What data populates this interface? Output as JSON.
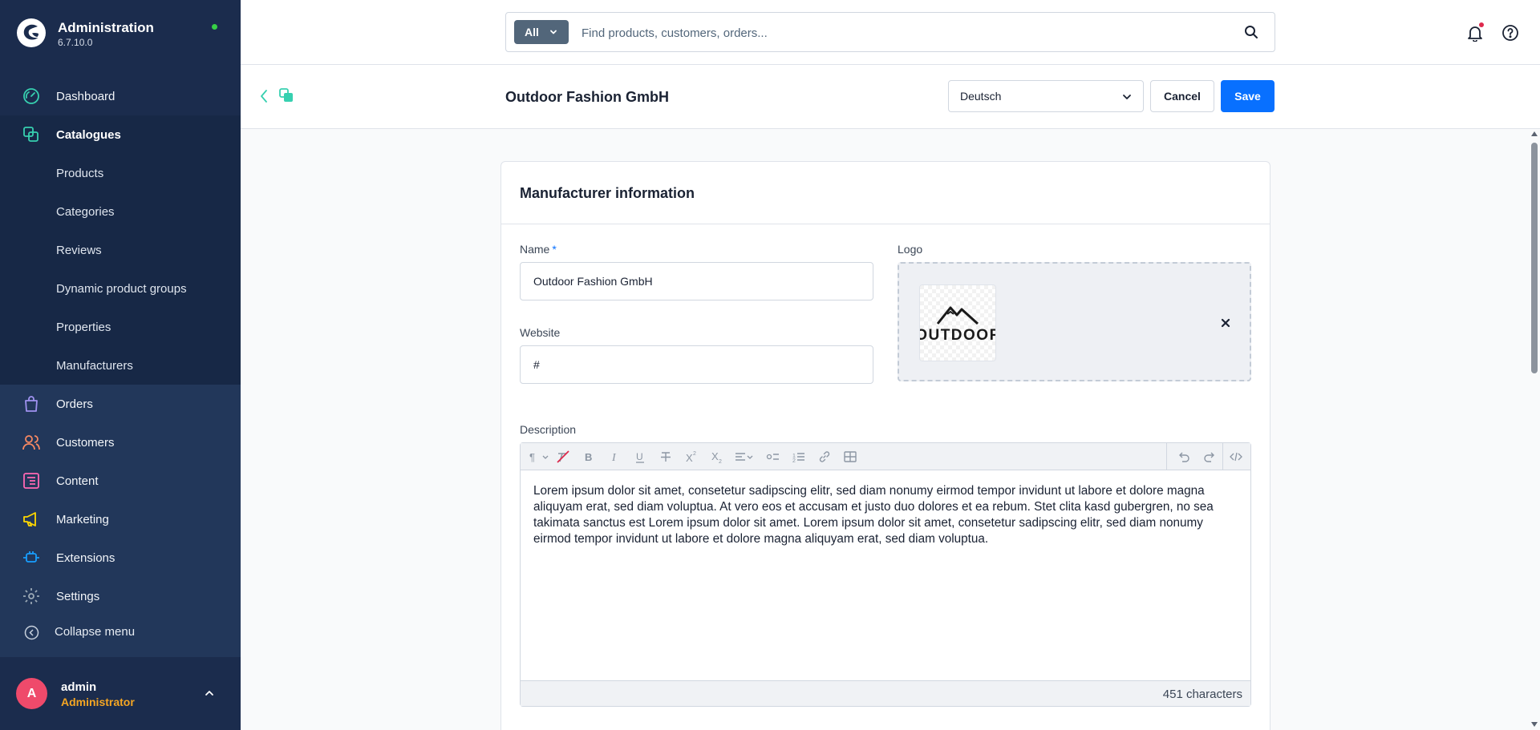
{
  "app": {
    "title": "Administration",
    "version": "6.7.10.0"
  },
  "sidebar": {
    "items": [
      {
        "label": "Dashboard",
        "icon": "dashboard-icon"
      },
      {
        "label": "Catalogues",
        "icon": "catalogues-icon"
      },
      {
        "label": "Orders",
        "icon": "orders-icon"
      },
      {
        "label": "Customers",
        "icon": "customers-icon"
      },
      {
        "label": "Content",
        "icon": "content-icon"
      },
      {
        "label": "Marketing",
        "icon": "marketing-icon"
      },
      {
        "label": "Extensions",
        "icon": "extensions-icon"
      },
      {
        "label": "Settings",
        "icon": "settings-icon"
      }
    ],
    "catalogue_sub": [
      {
        "label": "Products"
      },
      {
        "label": "Categories"
      },
      {
        "label": "Reviews"
      },
      {
        "label": "Dynamic product groups"
      },
      {
        "label": "Properties"
      },
      {
        "label": "Manufacturers"
      }
    ],
    "collapse_label": "Collapse menu",
    "active_item": "Catalogues",
    "colors": {
      "dashboard": "#37d0b0",
      "catalogues": "#37d0b0",
      "orders": "#a092f0",
      "customers": "#f88962",
      "content": "#ff68b4",
      "marketing": "#ffd700",
      "extensions": "#189eff",
      "settings": "#9aa8b5"
    }
  },
  "user": {
    "initial": "A",
    "name": "admin",
    "role": "Administrator"
  },
  "search": {
    "type_label": "All",
    "placeholder": "Find products, customers, orders..."
  },
  "smartbar": {
    "title": "Outdoor Fashion GmbH",
    "language": "Deutsch",
    "cancel_label": "Cancel",
    "save_label": "Save"
  },
  "card": {
    "title": "Manufacturer information",
    "name_label": "Name",
    "required_marker": "*",
    "name_value": "Outdoor Fashion GmbH",
    "website_label": "Website",
    "website_value": "#",
    "logo_label": "Logo",
    "logo_text": "OUTDOOR",
    "description_label": "Description",
    "description_text": "Lorem ipsum dolor sit amet, consetetur sadipscing elitr, sed diam nonumy eirmod tempor invidunt ut labore et dolore magna aliquyam erat, sed diam voluptua. At vero eos et accusam et justo duo dolores et ea rebum. Stet clita kasd gubergren, no sea takimata sanctus est Lorem ipsum dolor sit amet. Lorem ipsum dolor sit amet, consetetur sadipscing elitr, sed diam nonumy eirmod tempor invidunt ut labore et dolore magna aliquyam erat, sed diam voluptua.",
    "char_count": "451 characters"
  },
  "accent": "#0870ff"
}
